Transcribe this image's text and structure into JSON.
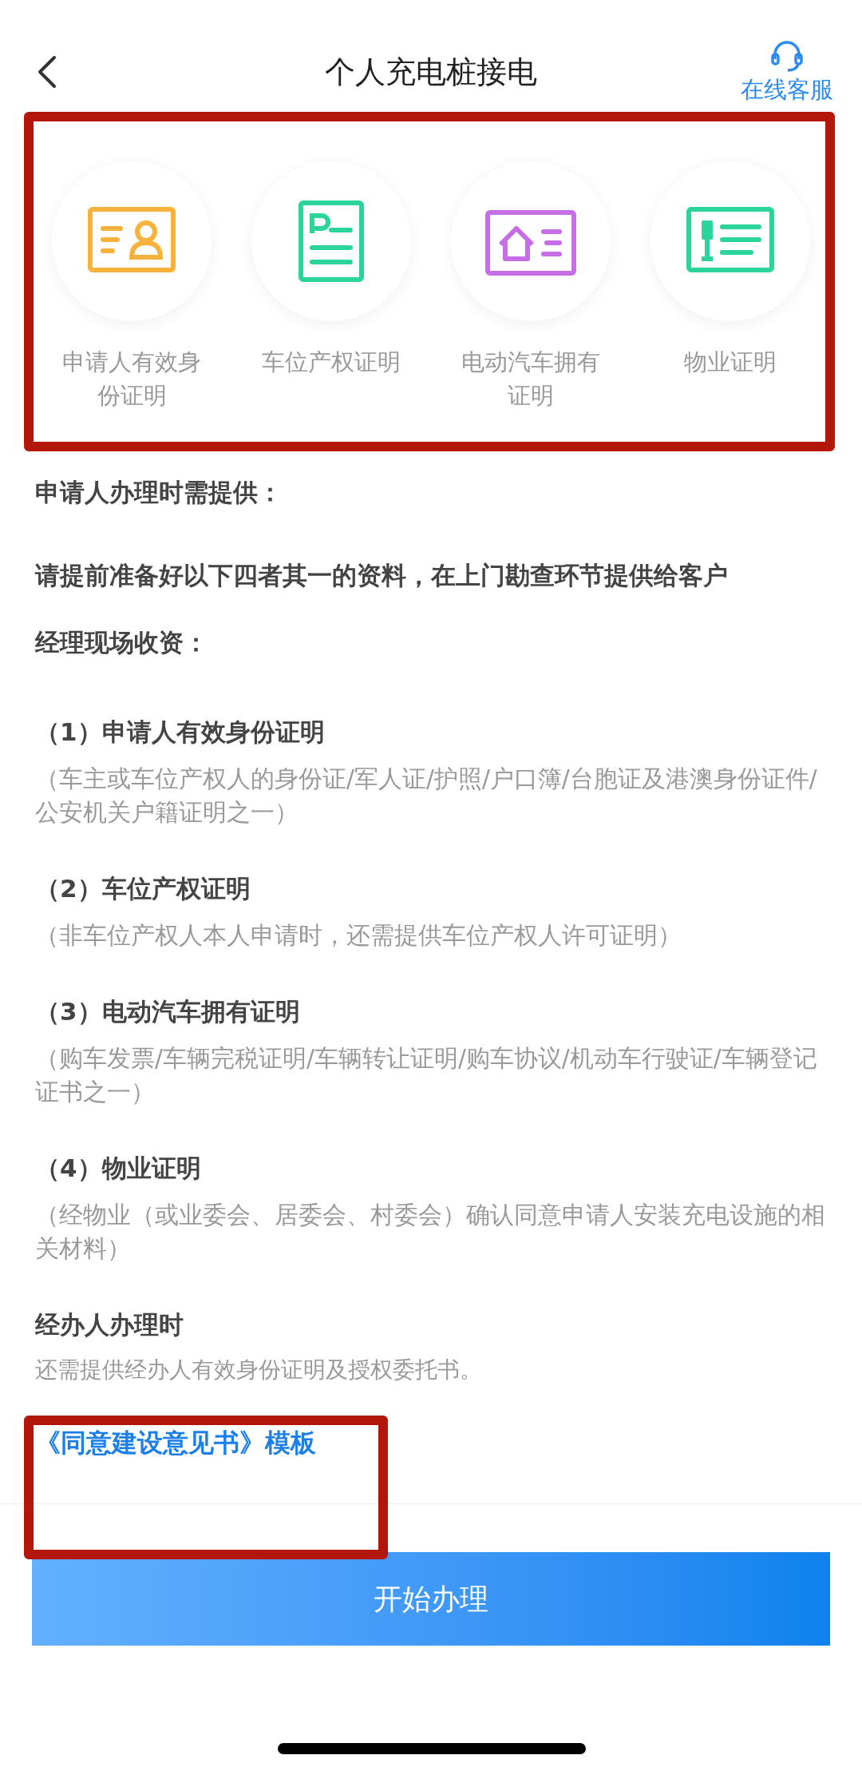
{
  "header": {
    "title": "个人充电桩接电",
    "service_label": "在线客服"
  },
  "documents": [
    {
      "label": "申请人有效身份证明",
      "kind": "id-card",
      "color": "#f7b23b"
    },
    {
      "label": "车位产权证明",
      "kind": "parking",
      "color": "#2bd49a"
    },
    {
      "label": "电动汽车拥有证明",
      "kind": "house",
      "color": "#c56ee6"
    },
    {
      "label": "物业证明",
      "kind": "license",
      "color": "#2bd49a"
    }
  ],
  "intro": [
    "申请人办理时需提供：",
    "请提前准备好以下四者其一的资料，在上门勘查环节提供给客户",
    "经理现场收资："
  ],
  "items": [
    {
      "title": "（1）申请人有效身份证明",
      "note": "（车主或车位产权人的身份证/军人证/护照/户口簿/台胞证及港澳身份证件/公安机关户籍证明之一）"
    },
    {
      "title": "（2）车位产权证明",
      "note": "（非车位产权人本人申请时，还需提供车位产权人许可证明）"
    },
    {
      "title": "（3）电动汽车拥有证明",
      "note": "（购车发票/车辆完税证明/车辆转让证明/购车协议/机动车行驶证/车辆登记证书之一）"
    },
    {
      "title": "（4）物业证明",
      "note": "（经物业（或业委会、居委会、村委会）确认同意申请人安装充电设施的相关材料）"
    }
  ],
  "agent": {
    "title": "经办人办理时",
    "note": "还需提供经办人有效身份证明及授权委托书。"
  },
  "template_link": "《同意建设意见书》模板",
  "start_button": "开始办理"
}
